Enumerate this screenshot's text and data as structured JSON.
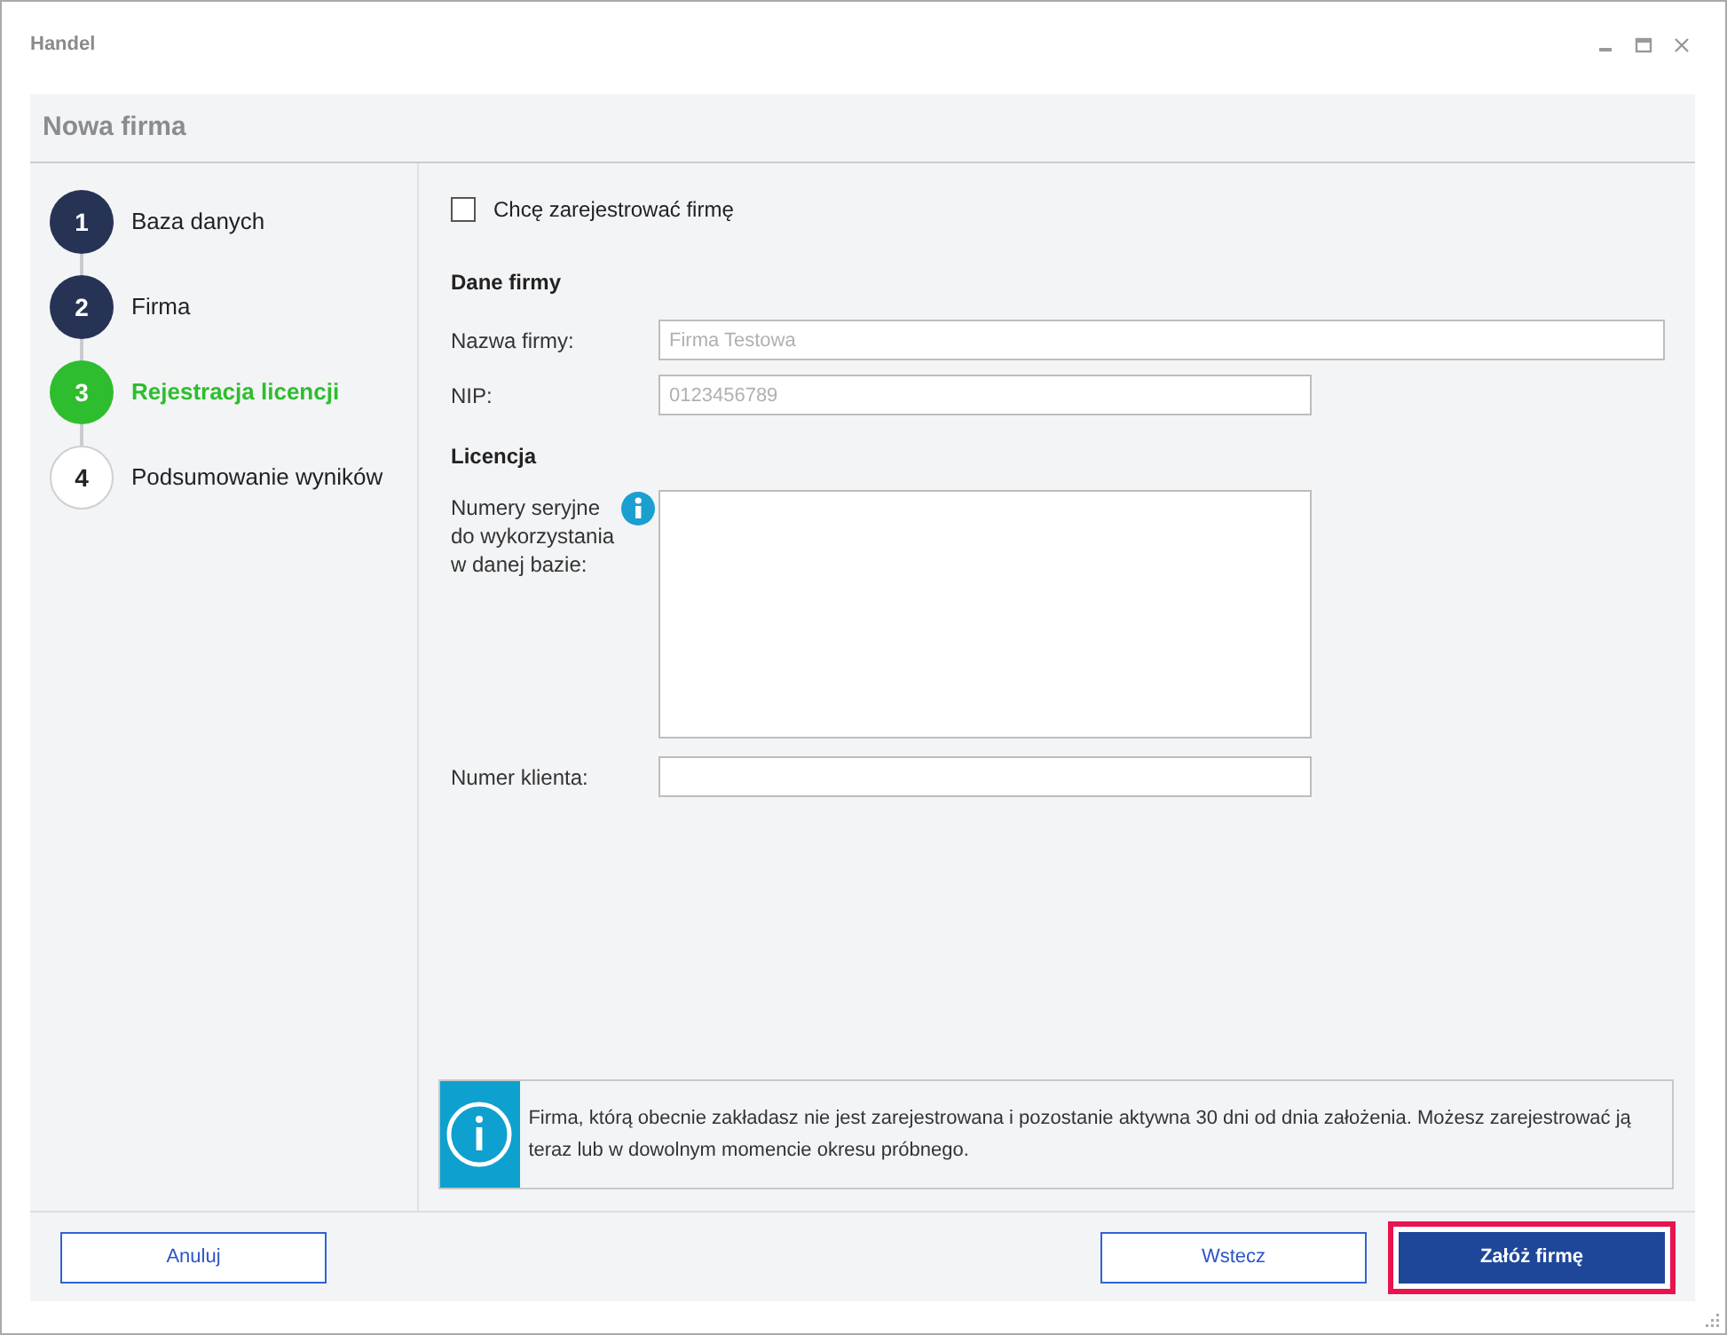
{
  "window": {
    "title": "Handel"
  },
  "header": {
    "title": "Nowa firma"
  },
  "steps": [
    {
      "number": "1",
      "label": "Baza danych",
      "completed": true,
      "selected": false
    },
    {
      "number": "2",
      "label": "Firma",
      "completed": true,
      "selected": false
    },
    {
      "number": "3",
      "label": "Rejestracja licencji",
      "completed": false,
      "selected": true
    },
    {
      "number": "4",
      "label": "Podsumowanie wyników",
      "completed": false,
      "selected": false
    }
  ],
  "register_checkbox": {
    "label": "Chcę zarejestrować firmę",
    "checked": false
  },
  "company_section": {
    "title": "Dane firmy",
    "fields": [
      {
        "label": "Nazwa firmy:",
        "placeholder": "Firma Testowa",
        "wide": true
      },
      {
        "label": "NIP:",
        "placeholder": "0123456789",
        "wide": false
      }
    ]
  },
  "license_section": {
    "title": "Licencja",
    "serials_label": "Numery seryjne do wykorzystania w danej bazie:",
    "client_label": "Numer klienta:"
  },
  "info_banner": {
    "text": "Firma, którą obecnie zakładasz nie jest zarejestrowana i pozostanie aktywna 30 dni od dnia założenia. Możesz zarejestrować ją teraz lub w dowolnym momencie okresu próbnego."
  },
  "buttons": [
    {
      "label": "Anuluj",
      "kind": "secondary",
      "highlighted": false
    },
    {
      "label": "Wstecz",
      "kind": "secondary",
      "highlighted": false
    },
    {
      "label": "Załóż firmę",
      "kind": "primary",
      "highlighted": true
    }
  ]
}
